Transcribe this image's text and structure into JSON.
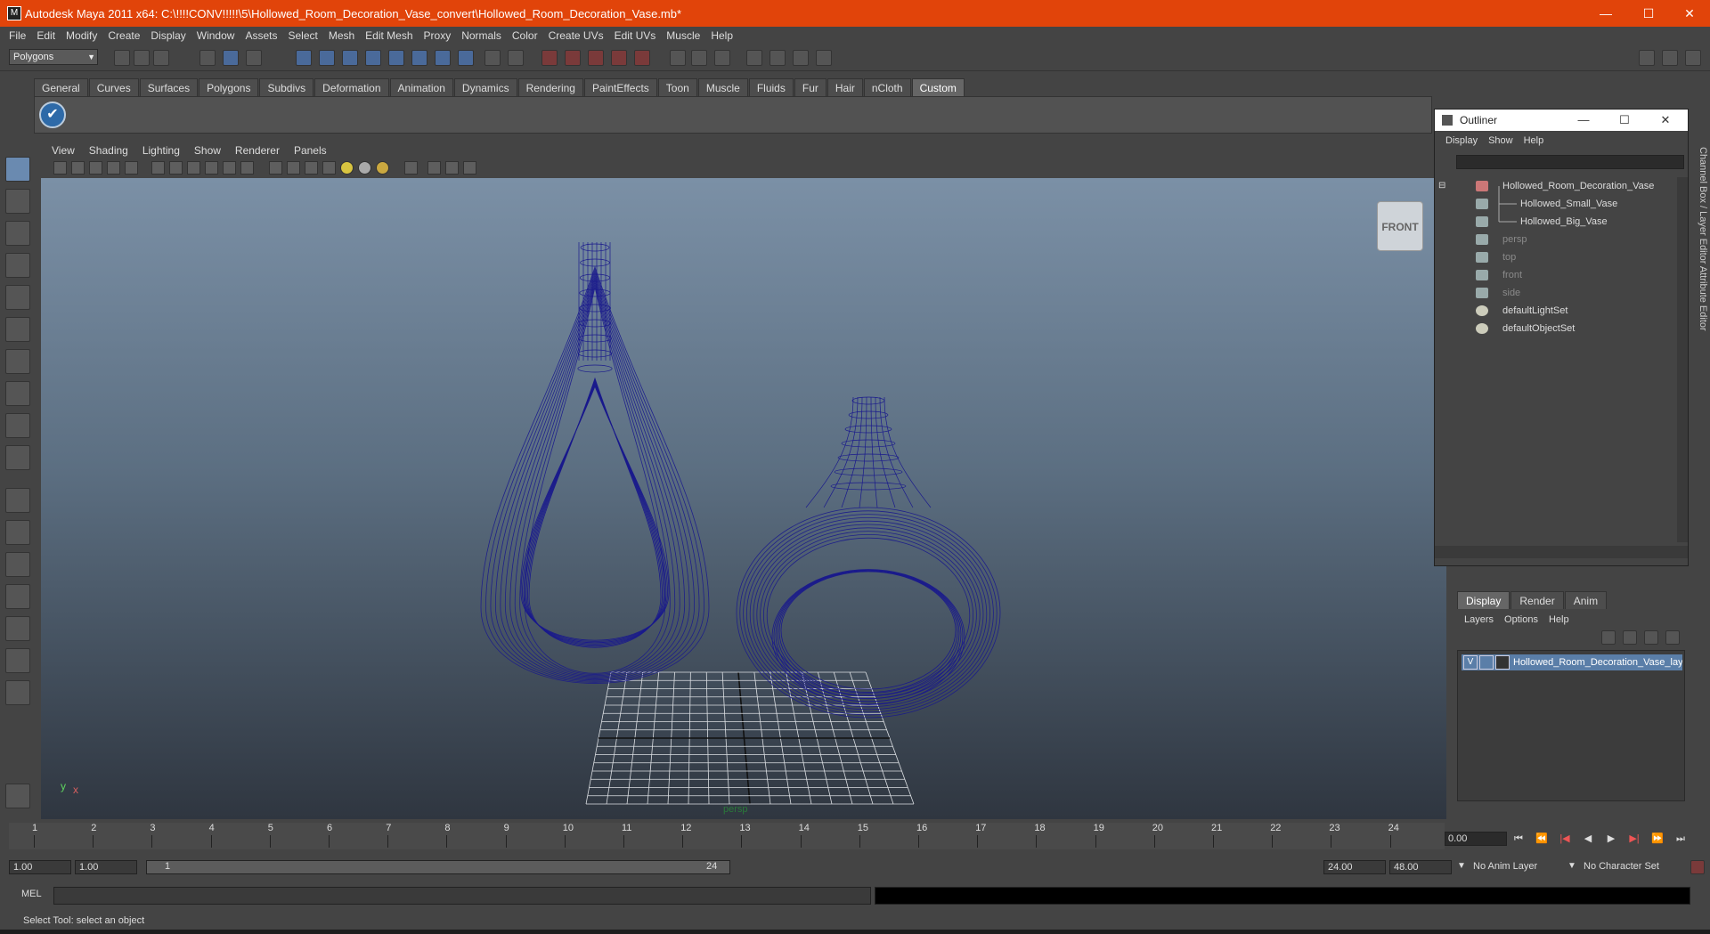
{
  "window": {
    "title": "Autodesk Maya 2011 x64: C:\\!!!!CONV!!!!!\\5\\Hollowed_Room_Decoration_Vase_convert\\Hollowed_Room_Decoration_Vase.mb*",
    "minimize": "—",
    "maximize": "☐",
    "close": "✕"
  },
  "menubar": [
    "File",
    "Edit",
    "Modify",
    "Create",
    "Display",
    "Window",
    "Assets",
    "Select",
    "Mesh",
    "Edit Mesh",
    "Proxy",
    "Normals",
    "Color",
    "Create UVs",
    "Edit UVs",
    "Muscle",
    "Help"
  ],
  "status_line": {
    "mode": "Polygons"
  },
  "shelf": {
    "tabs": [
      "General",
      "Curves",
      "Surfaces",
      "Polygons",
      "Subdivs",
      "Deformation",
      "Animation",
      "Dynamics",
      "Rendering",
      "PaintEffects",
      "Toon",
      "Muscle",
      "Fluids",
      "Fur",
      "Hair",
      "nCloth",
      "Custom"
    ],
    "active_tab": "Custom",
    "button_glyph": "✔"
  },
  "viewport": {
    "menu": [
      "View",
      "Shading",
      "Lighting",
      "Show",
      "Renderer",
      "Panels"
    ],
    "view_cube": "FRONT",
    "camera": "persp",
    "axis_y": "y",
    "axis_x": "x",
    "wire_color": "#1a1a8c"
  },
  "outliner": {
    "title": "Outliner",
    "menu": [
      "Display",
      "Show",
      "Help"
    ],
    "items": [
      {
        "name": "Hollowed_Room_Decoration_Vase"
      },
      {
        "name": "Hollowed_Small_Vase"
      },
      {
        "name": "Hollowed_Big_Vase"
      },
      {
        "name": "persp"
      },
      {
        "name": "top"
      },
      {
        "name": "front"
      },
      {
        "name": "side"
      },
      {
        "name": "defaultLightSet"
      },
      {
        "name": "defaultObjectSet"
      }
    ]
  },
  "side_tabs": "Channel Box / Layer Editor    Attribute Editor",
  "layer_editor": {
    "tabs": [
      "Display",
      "Render",
      "Anim"
    ],
    "active_tab": "Display",
    "menu": [
      "Layers",
      "Options",
      "Help"
    ],
    "layer": {
      "visible": "V",
      "name": "Hollowed_Room_Decoration_Vase_lay"
    }
  },
  "timeline": {
    "ticks": [
      "1",
      "2",
      "3",
      "4",
      "5",
      "6",
      "7",
      "8",
      "9",
      "10",
      "11",
      "12",
      "13",
      "14",
      "15",
      "16",
      "17",
      "18",
      "19",
      "20",
      "21",
      "22",
      "23",
      "24"
    ],
    "current_time": "0.00",
    "playback": [
      "⏮",
      "⏪",
      "|◀",
      "◀",
      "▶",
      "▶|",
      "⏩",
      "⏭"
    ]
  },
  "range": {
    "start_time": "1.00",
    "playback_start": "1.00",
    "bar_start": "1",
    "bar_end": "24",
    "playback_end": "24.00",
    "end_time": "48.00",
    "anim_layer": "No Anim Layer",
    "character_set": "No Character Set"
  },
  "command": {
    "label": "MEL"
  },
  "helpline": "Select Tool: select an object"
}
